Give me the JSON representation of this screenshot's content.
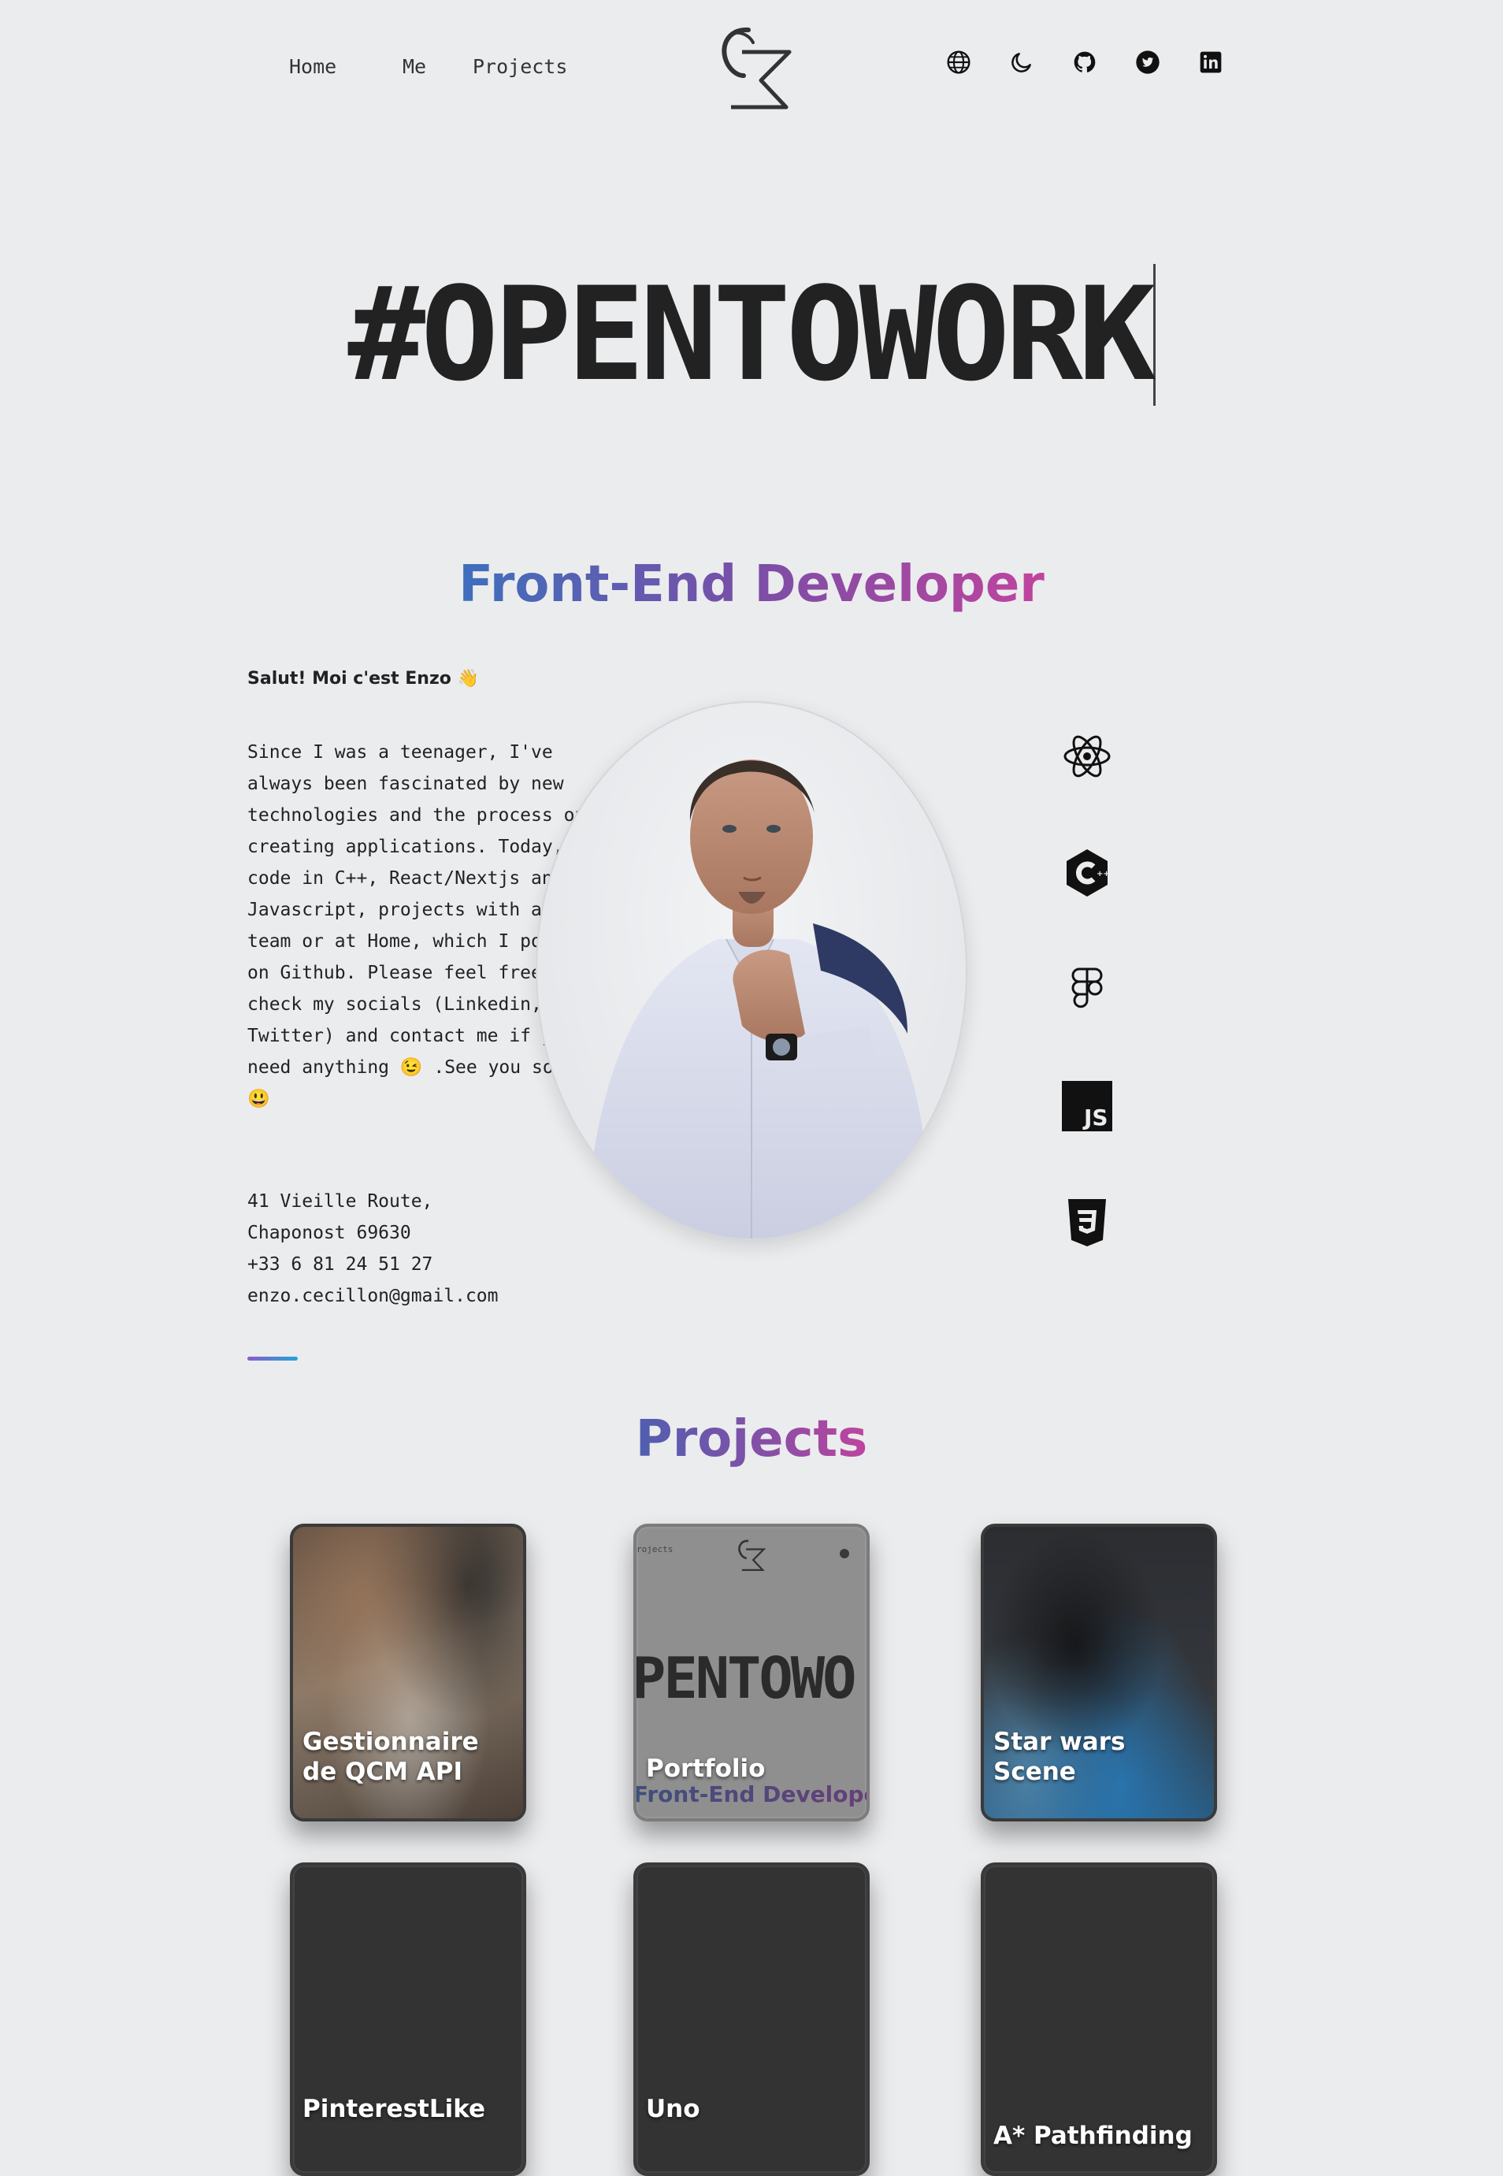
{
  "nav": {
    "links": [
      "Home",
      "Me",
      "Projects"
    ],
    "icons": [
      "globe-icon",
      "moon-icon",
      "github-icon",
      "twitter-icon",
      "linkedin-icon"
    ]
  },
  "hero": {
    "text": "#OPENTOWORK"
  },
  "about": {
    "role": "Front-End Developer",
    "greeting": "Salut! Moi c'est Enzo 👋",
    "bio": "Since I was a teenager, I've always been fascinated by new technologies and the process of creating applications. Today, I code in C++, React/Nextjs and Javascript, projects with a team or at Home, which I post on Github. Please feel free to check my socials (Linkedin, Twitter) and contact me if you need anything 😉 .See you soon!😃",
    "address": {
      "line1": "41 Vieille Route,",
      "line2": "Chaponost 69630",
      "phone": "+33 6 81 24 51 27",
      "email": "enzo.cecillon@gmail.com"
    },
    "skills": [
      "react-icon",
      "cplusplus-icon",
      "figma-icon",
      "javascript-icon",
      "css3-icon"
    ],
    "skill_js_label": "JS"
  },
  "projects": {
    "title": "Projects",
    "items": [
      {
        "title": "Gestionnaire de QCM API"
      },
      {
        "title": "Portfolio",
        "preview_header": "rojects",
        "preview_big": "PENTOWO",
        "preview_sub": "Front-End Developer"
      },
      {
        "title": "Star wars Scene"
      },
      {
        "title": "PinterestLike"
      },
      {
        "title": "Uno"
      },
      {
        "title": "A* Pathfinding"
      }
    ]
  },
  "colors": {
    "background": "#ebecee",
    "gradient_start": "#3e6fbd",
    "gradient_end": "#c0449e",
    "text": "#222222"
  }
}
